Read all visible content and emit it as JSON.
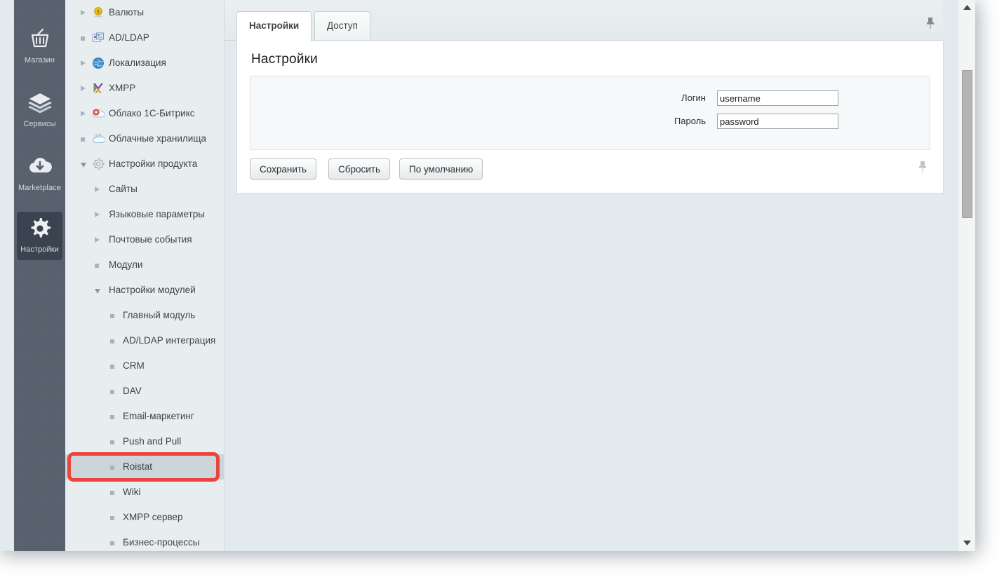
{
  "rail": {
    "items": [
      {
        "label": "Магазин",
        "icon": "basket-icon",
        "active": false
      },
      {
        "label": "Сервисы",
        "icon": "layers-icon",
        "active": false
      },
      {
        "label": "Marketplace",
        "icon": "cloud-down-icon",
        "active": false
      },
      {
        "label": "Настройки",
        "icon": "gear-icon",
        "active": true
      }
    ]
  },
  "tree": {
    "items": [
      {
        "label": "Валюты",
        "depth": 1,
        "marker": "closed",
        "icon": "currency-icon",
        "selected": false
      },
      {
        "label": "AD/LDAP",
        "depth": 1,
        "marker": "bullet",
        "icon": "ldap-icon",
        "selected": false
      },
      {
        "label": "Локализация",
        "depth": 1,
        "marker": "closed",
        "icon": "globe-icon",
        "selected": false
      },
      {
        "label": "XMPP",
        "depth": 1,
        "marker": "closed",
        "icon": "xmpp-icon",
        "selected": false
      },
      {
        "label": "Облако 1С-Битрикс",
        "depth": 1,
        "marker": "closed",
        "icon": "cloud-red-icon",
        "selected": false
      },
      {
        "label": "Облачные хранилища",
        "depth": 1,
        "marker": "bullet",
        "icon": "cloud-blue-icon",
        "selected": false
      },
      {
        "label": "Настройки продукта",
        "depth": 1,
        "marker": "open",
        "icon": "gear-gray-icon",
        "selected": false
      },
      {
        "label": "Сайты",
        "depth": 2,
        "marker": "closed",
        "icon": "",
        "selected": false
      },
      {
        "label": "Языковые параметры",
        "depth": 2,
        "marker": "closed",
        "icon": "",
        "selected": false
      },
      {
        "label": "Почтовые события",
        "depth": 2,
        "marker": "closed",
        "icon": "",
        "selected": false
      },
      {
        "label": "Модули",
        "depth": 2,
        "marker": "bullet",
        "icon": "",
        "selected": false
      },
      {
        "label": "Настройки модулей",
        "depth": 2,
        "marker": "open",
        "icon": "",
        "selected": false
      },
      {
        "label": "Главный модуль",
        "depth": 3,
        "marker": "bullet",
        "icon": "",
        "selected": false
      },
      {
        "label": "AD/LDAP интеграция",
        "depth": 3,
        "marker": "bullet",
        "icon": "",
        "selected": false
      },
      {
        "label": "CRM",
        "depth": 3,
        "marker": "bullet",
        "icon": "",
        "selected": false
      },
      {
        "label": "DAV",
        "depth": 3,
        "marker": "bullet",
        "icon": "",
        "selected": false
      },
      {
        "label": "Email-маркетинг",
        "depth": 3,
        "marker": "bullet",
        "icon": "",
        "selected": false
      },
      {
        "label": "Push and Pull",
        "depth": 3,
        "marker": "bullet",
        "icon": "",
        "selected": false
      },
      {
        "label": "Roistat",
        "depth": 3,
        "marker": "bullet",
        "icon": "",
        "selected": true
      },
      {
        "label": "Wiki",
        "depth": 3,
        "marker": "bullet",
        "icon": "",
        "selected": false
      },
      {
        "label": "XMPP сервер",
        "depth": 3,
        "marker": "bullet",
        "icon": "",
        "selected": false
      },
      {
        "label": "Бизнес-процессы",
        "depth": 3,
        "marker": "bullet",
        "icon": "",
        "selected": false
      }
    ],
    "highlight": {
      "target_label": "Roistat",
      "color": "#e8453c"
    }
  },
  "tabs": [
    {
      "label": "Настройки",
      "active": true
    },
    {
      "label": "Доступ",
      "active": false
    }
  ],
  "panel": {
    "title": "Настройки",
    "fields": [
      {
        "label": "Логин",
        "value": "username",
        "placeholder": "",
        "type": "text"
      },
      {
        "label": "Пароль",
        "value": "password",
        "placeholder": "",
        "type": "text"
      }
    ],
    "buttons": [
      {
        "label": "Сохранить"
      },
      {
        "label": "Сбросить"
      },
      {
        "label": "По умолчанию"
      }
    ]
  },
  "icons": {
    "tab_pin": "pin-icon",
    "bar_pin": "pin-icon",
    "scroll_up": "scroll-up-arrow-icon",
    "scroll_down": "scroll-down-arrow-icon"
  },
  "colors": {
    "page_background": "#e3eaed",
    "rail_background": "#565f6b",
    "rail_active": "#3a4350",
    "tree_background": "#e8eef0",
    "tree_selected": "#ccd5d9",
    "highlight_red": "#e8453c",
    "panel_background": "#ffffff",
    "form_background": "#f6f8f9"
  }
}
